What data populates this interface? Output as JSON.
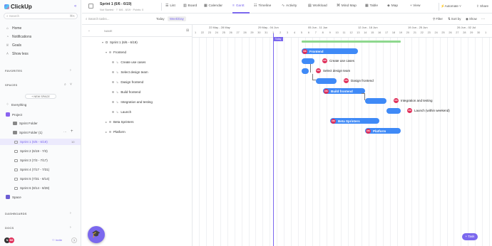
{
  "app": {
    "name": "ClickUp",
    "search_placeholder": "Search",
    "search_shortcut": "⌘K"
  },
  "nav": [
    {
      "label": "Home",
      "icon": "home-icon"
    },
    {
      "label": "Notifications",
      "icon": "bell-icon"
    },
    {
      "label": "Goals",
      "icon": "trophy-icon"
    },
    {
      "label": "Show less",
      "icon": "chevron-up-icon"
    }
  ],
  "sections": {
    "favorites": "FAVORITES",
    "spaces": "SPACES",
    "dashboards": "DASHBOARDS",
    "docs": "DOCS"
  },
  "new_space": "+ NEW SPACE",
  "tree": {
    "everything": "Everything",
    "project": "Project",
    "sprint_folder": "Sprint Folder",
    "sprint_folder_1": "Sprint Folder (1)",
    "sprints": [
      {
        "label": "Sprint 1 (6/6 - 6/19)",
        "count": "10"
      },
      {
        "label": "Sprint 2 (6/19 - 7/3)",
        "count": ""
      },
      {
        "label": "Sprint 3 (7/3 - 7/17)",
        "count": ""
      },
      {
        "label": "Sprint 4 (7/17 - 7/31)",
        "count": ""
      },
      {
        "label": "Sprint 5 (7/31 - 8/14)",
        "count": ""
      },
      {
        "label": "Sprint 6 (8/14 - 8/28)",
        "count": ""
      }
    ],
    "space": "Space"
  },
  "footer": {
    "invite": "Invite",
    "help": "?",
    "avatar_initial": "N"
  },
  "header": {
    "title": "Sprint 1 (6/6 - 6/19)",
    "subtitle": "Not Started · ⚐ 6/6 - 6/19 · Points: 0",
    "tabs": [
      {
        "label": "List",
        "icon": "list-icon"
      },
      {
        "label": "Board",
        "icon": "board-icon"
      },
      {
        "label": "Calendar",
        "icon": "calendar-icon"
      },
      {
        "label": "Gantt",
        "icon": "gantt-icon",
        "active": true
      },
      {
        "label": "Timeline",
        "icon": "timeline-icon"
      },
      {
        "label": "Activity",
        "icon": "activity-icon"
      },
      {
        "label": "Workload",
        "icon": "workload-icon"
      },
      {
        "label": "Mind Map",
        "icon": "mindmap-icon"
      },
      {
        "label": "Table",
        "icon": "table-icon"
      },
      {
        "label": "Map",
        "icon": "map-icon"
      },
      {
        "label": "+ View",
        "icon": ""
      }
    ],
    "automate": "Automate",
    "share": "Share"
  },
  "toolbar": {
    "search_placeholder": "Search tasks...",
    "today": "Today",
    "week": "Week/Day",
    "filter": "Filter",
    "sort": "Sort by",
    "show": "Show"
  },
  "grid": {
    "name_header": "NAME",
    "rows": [
      {
        "label": "Sprint 1 (6/6 - 6/19)"
      },
      {
        "label": "Frontend"
      },
      {
        "label": "Create use cases"
      },
      {
        "label": "Select design team"
      },
      {
        "label": "Dasign frontend"
      },
      {
        "label": "Build frontend"
      },
      {
        "label": "Integration and testing"
      },
      {
        "label": "Launch"
      },
      {
        "label": "Beta Sprinters"
      },
      {
        "label": "Platform"
      }
    ]
  },
  "gantt": {
    "weeks": [
      "22 May - 28 May",
      "29 May - 04 Jun",
      "05 Jun - 11 Jun",
      "12 Jun - 18 Jun",
      "19 Jun - 25 Jun",
      "26 Jun - 02 Jul"
    ],
    "days": [
      "1",
      "22",
      "23",
      "24",
      "25",
      "26",
      "27",
      "28",
      "29",
      "30",
      "31",
      "1",
      "2",
      "3",
      "4",
      "5",
      "6",
      "7",
      "8",
      "9",
      "10",
      "11",
      "12",
      "13",
      "14",
      "15",
      "16",
      "17",
      "18",
      "19",
      "20",
      "21",
      "22",
      "23",
      "24",
      "25",
      "26",
      "27",
      "28",
      "29",
      "30",
      "1",
      "2"
    ],
    "today_label": "Today",
    "bars": [
      {
        "label": "Frontend",
        "inside": true,
        "initials": "NS"
      },
      {
        "label": "Create use cases",
        "initials": "NS"
      },
      {
        "label": "Select design team",
        "initials": "NS"
      },
      {
        "label": "Dasign frontend",
        "initials": "NS"
      },
      {
        "label": "Build frontend",
        "inside": true,
        "initials": "NS"
      },
      {
        "label": "Integration and testing",
        "initials": "NS"
      },
      {
        "label": "Launch (within weekend)",
        "initials": "NS"
      },
      {
        "label": "Beta Sprinters",
        "inside": true,
        "initials": "NS"
      },
      {
        "label": "Platform",
        "inside": true,
        "initials": "NS"
      }
    ],
    "add_task": "+ Task"
  },
  "colors": {
    "accent": "#7b68ee",
    "bar": "#3f8af7",
    "avatar": "#e0305a",
    "progress": "#8ed88e"
  }
}
